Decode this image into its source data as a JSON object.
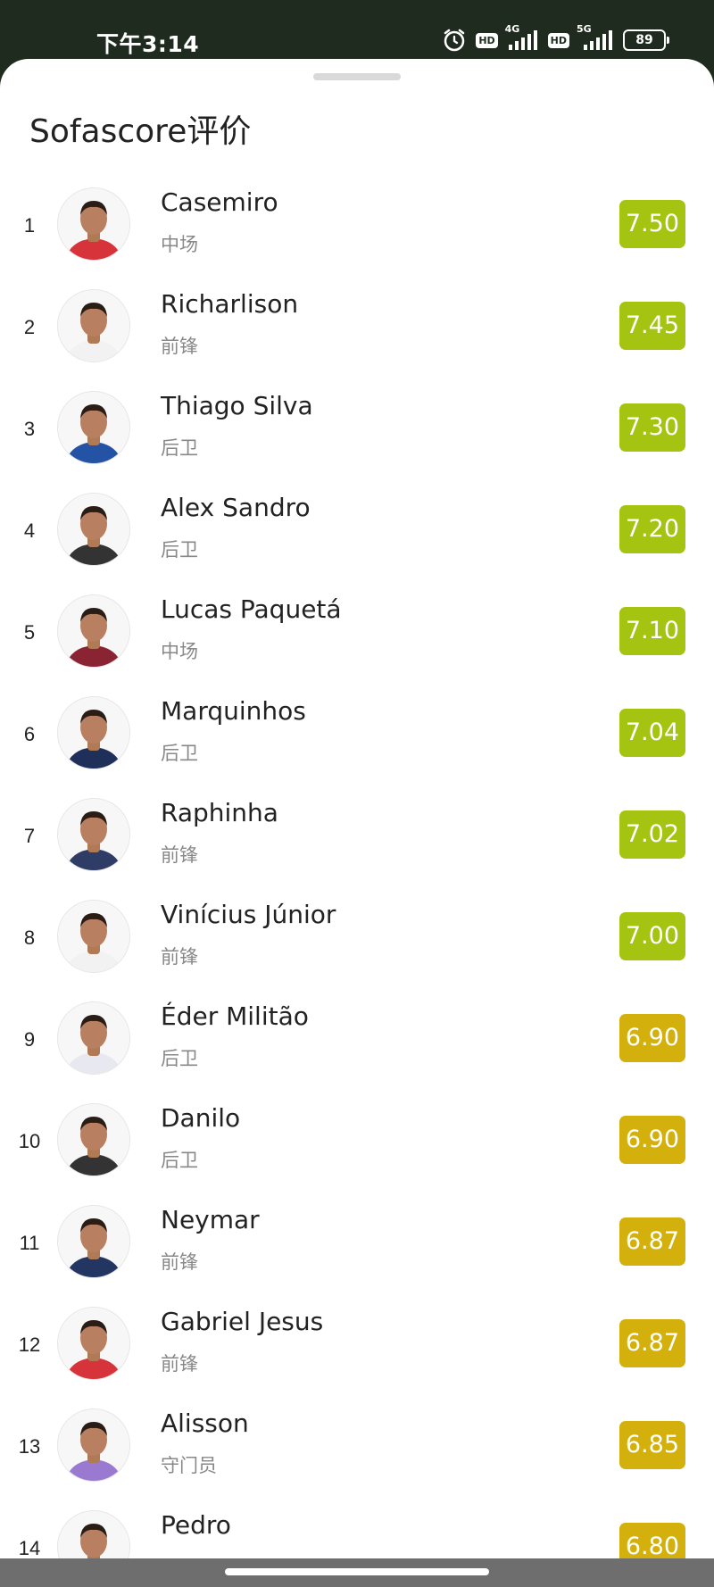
{
  "status": {
    "time": "下午3:14",
    "hd1": "HD",
    "net1": "4G",
    "hd2": "HD",
    "net2": "5G",
    "battery": "89"
  },
  "header": {
    "title": "Sofascore评价"
  },
  "colors": {
    "rating_green": "#a4c411",
    "rating_yellow": "#d4b00c"
  },
  "players": [
    {
      "rank": "1",
      "name": "Casemiro",
      "position": "中场",
      "rating": "7.50",
      "tier": "green",
      "kit": "#d7333a"
    },
    {
      "rank": "2",
      "name": "Richarlison",
      "position": "前锋",
      "rating": "7.45",
      "tier": "green",
      "kit": "#f2f2f2"
    },
    {
      "rank": "3",
      "name": "Thiago Silva",
      "position": "后卫",
      "rating": "7.30",
      "tier": "green",
      "kit": "#2453a6"
    },
    {
      "rank": "4",
      "name": "Alex Sandro",
      "position": "后卫",
      "rating": "7.20",
      "tier": "green",
      "kit": "#333333"
    },
    {
      "rank": "5",
      "name": "Lucas Paquetá",
      "position": "中场",
      "rating": "7.10",
      "tier": "green",
      "kit": "#8a2432"
    },
    {
      "rank": "6",
      "name": "Marquinhos",
      "position": "后卫",
      "rating": "7.04",
      "tier": "green",
      "kit": "#1e2f5a"
    },
    {
      "rank": "7",
      "name": "Raphinha",
      "position": "前锋",
      "rating": "7.02",
      "tier": "green",
      "kit": "#2e3c66"
    },
    {
      "rank": "8",
      "name": "Vinícius Júnior",
      "position": "前锋",
      "rating": "7.00",
      "tier": "green",
      "kit": "#f2f2f2"
    },
    {
      "rank": "9",
      "name": "Éder Militão",
      "position": "后卫",
      "rating": "6.90",
      "tier": "yellow",
      "kit": "#e8e8f0"
    },
    {
      "rank": "10",
      "name": "Danilo",
      "position": "后卫",
      "rating": "6.90",
      "tier": "yellow",
      "kit": "#333333"
    },
    {
      "rank": "11",
      "name": "Neymar",
      "position": "前锋",
      "rating": "6.87",
      "tier": "yellow",
      "kit": "#233561"
    },
    {
      "rank": "12",
      "name": "Gabriel Jesus",
      "position": "前锋",
      "rating": "6.87",
      "tier": "yellow",
      "kit": "#d7333a"
    },
    {
      "rank": "13",
      "name": "Alisson",
      "position": "守门员",
      "rating": "6.85",
      "tier": "yellow",
      "kit": "#9a7ad0"
    },
    {
      "rank": "14",
      "name": "Pedro",
      "position": "",
      "rating": "6.80",
      "tier": "yellow",
      "kit": "#d7333a"
    }
  ]
}
